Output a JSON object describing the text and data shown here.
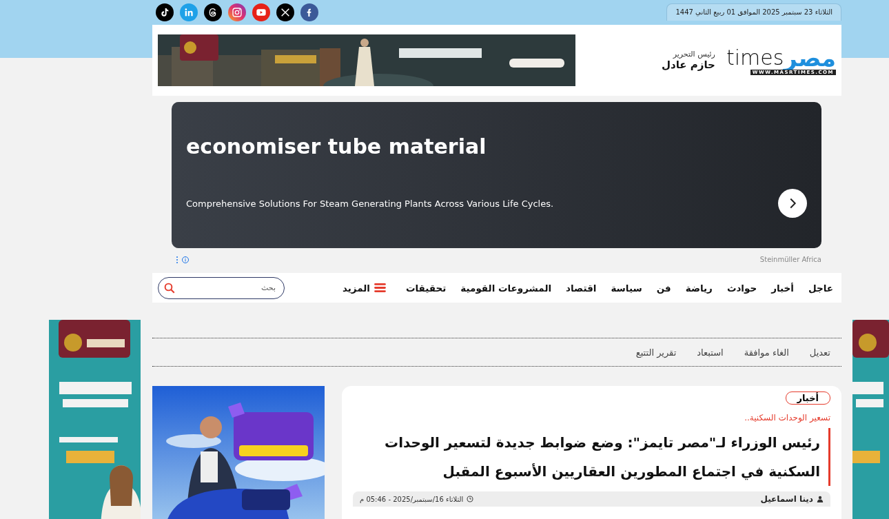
{
  "top_bar": {
    "date": "الثلاثاء 23 سبتمبر 2025 الموافق 01 ربيع الثاني 1447",
    "social_links": [
      {
        "kind": "tiktok"
      },
      {
        "kind": "linkedin"
      },
      {
        "kind": "threads"
      },
      {
        "kind": "instagram"
      },
      {
        "kind": "youtube"
      },
      {
        "kind": "x"
      },
      {
        "kind": "facebook"
      }
    ]
  },
  "header": {
    "logo": {
      "arabic": "مصر",
      "latin": "times",
      "url": "WWW.MASRTIMES.COM"
    },
    "editor": {
      "role": "رئيس التحرير",
      "name": "حازم عادل"
    }
  },
  "sponsored_ad": {
    "title": "economiser tube material",
    "description": "Comprehensive Solutions For Steam Generating Plants Across Various Life Cycles.",
    "advertiser": "Steinmüller Africa"
  },
  "nav": {
    "items": [
      "عاجل",
      "أخبار",
      "حوادث",
      "رياضة",
      "فن",
      "سياسة",
      "اقتصاد",
      "المشروعات القومية",
      "تحقيقات"
    ],
    "more": "المزيد",
    "search": {
      "placeholder": "بحث"
    }
  },
  "moderation_links": [
    "تعديل",
    "الغاء موافقة",
    "استبعاد",
    "تقرير التتبع"
  ],
  "article": {
    "category": "أخبار",
    "kicker": "تسعير الوحدات السكنية..",
    "title": "رئيس الوزراء لـ\"مصر تايمز\": وضع ضوابط جديدة لتسعير الوحدات السكنية في اجتماع المطورين العقاريين الأسبوع المقبل",
    "author": "دينا اسماعيل",
    "date": "الثلاثاء 16/سبتمبر/2025 - 05:46 م"
  }
}
